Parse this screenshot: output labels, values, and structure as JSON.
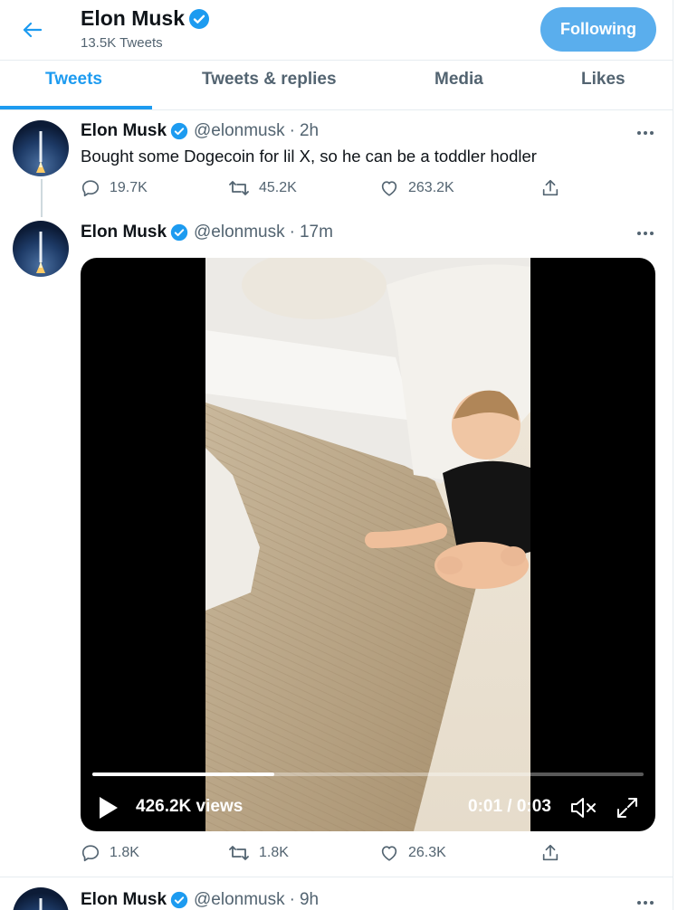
{
  "header": {
    "name": "Elon Musk",
    "tweet_count": "13.5K Tweets",
    "follow_button": "Following"
  },
  "tabs": [
    {
      "label": "Tweets",
      "active": true
    },
    {
      "label": "Tweets & replies",
      "active": false
    },
    {
      "label": "Media",
      "active": false
    },
    {
      "label": "Likes",
      "active": false
    }
  ],
  "tweets": [
    {
      "name": "Elon Musk",
      "handle": "@elonmusk",
      "separator": "·",
      "time": "2h",
      "text": "Bought some Dogecoin for lil X, so he can be a toddler hodler",
      "replies": "19.7K",
      "retweets": "45.2K",
      "likes": "263.2K"
    },
    {
      "name": "Elon Musk",
      "handle": "@elonmusk",
      "separator": "·",
      "time": "17m",
      "video": {
        "views": "426.2K views",
        "timecode": "0:01 / 0:03",
        "progress": 0.33
      },
      "replies": "1.8K",
      "retweets": "1.8K",
      "likes": "26.3K"
    },
    {
      "name": "Elon Musk",
      "handle": "@elonmusk",
      "separator": "·",
      "time": "9h"
    }
  ],
  "colors": {
    "accent": "#1d9bf0",
    "following_button": "#5aaeed",
    "secondary_text": "#536471"
  },
  "icons": [
    "back-arrow-icon",
    "verified-badge-icon",
    "more-icon",
    "reply-icon",
    "retweet-icon",
    "like-icon",
    "share-icon",
    "play-icon",
    "mute-icon",
    "fullscreen-icon"
  ]
}
